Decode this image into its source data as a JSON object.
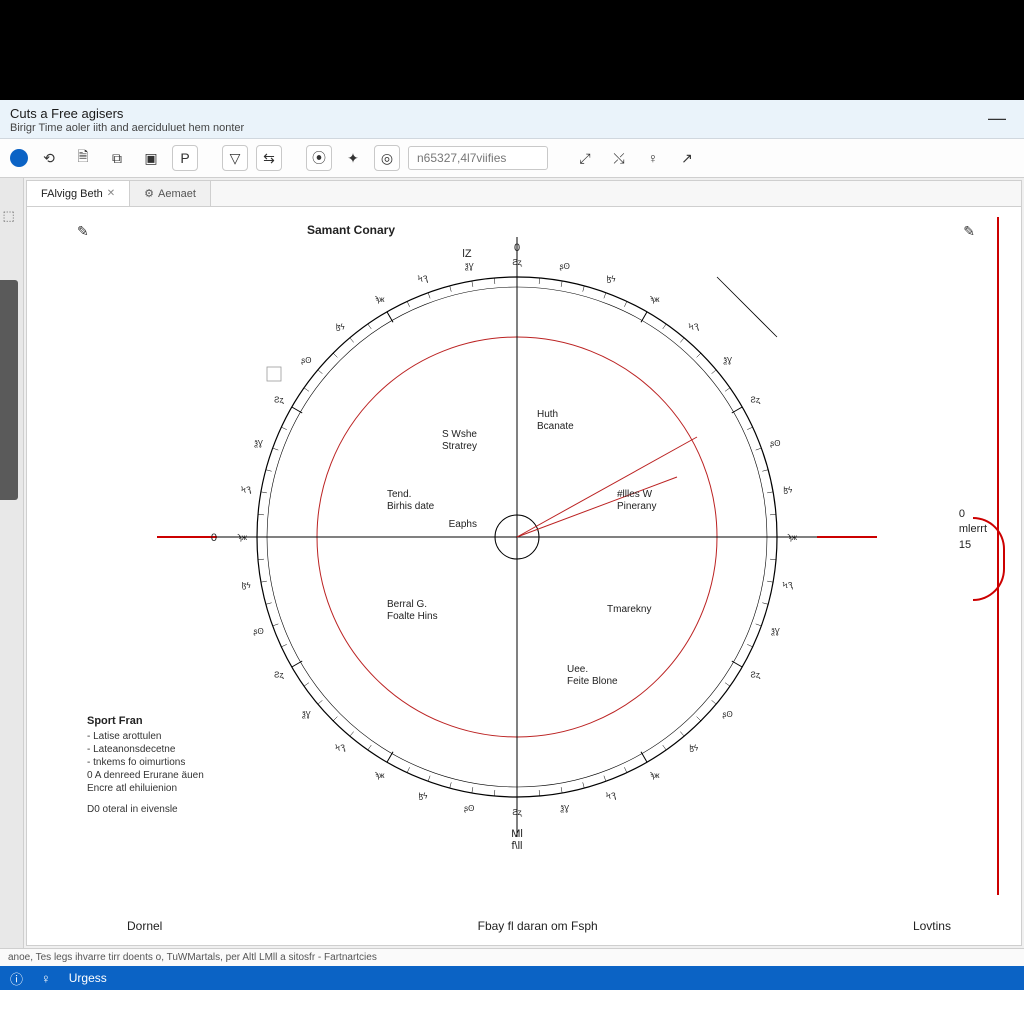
{
  "window": {
    "title": "Cuts a Free agisers",
    "subtitle": "Birigr Time aoler iith and aerciduluet hem nonter",
    "minimize": "—"
  },
  "toolbar": {
    "field_value": "n65327,4l7viifies"
  },
  "tabs": [
    {
      "label": "FAlvigg Beth",
      "closable": true
    },
    {
      "label": "Aemaet",
      "icon": "⚙"
    }
  ],
  "chart": {
    "title": "Samant Conary",
    "top_axis": "0",
    "top_axis_tick": "lZ",
    "left_mark": "0",
    "right": {
      "zero": "0",
      "label": "mlerrt",
      "val": "15"
    },
    "bottom_pair": {
      "a": "Ml",
      "b": "f\\ll"
    },
    "inner_labels": {
      "huth": "Huth",
      "bcanate": "Bcanate",
      "swhe": "S Wshe",
      "stratety": "Stratrey",
      "tend": "Tend.",
      "birhsdate": "Birhis date",
      "eaphs": "Eaphs",
      "altesw": "#llles W",
      "pinerany": "Pinerany",
      "berral": "Berral G.",
      "foalte": "Foalte Hins",
      "tmarekny": "Tmarekny",
      "uee": "Uee.",
      "feite": "Feite Blone"
    }
  },
  "legend": {
    "title": "Sport Fran",
    "items": [
      "- Latise arottulen",
      "- Lateanonsdecetne",
      "- tnkems fo oimurtions",
      "0 A denreed Erurane äuen",
      "  Encre atl ehiluienion"
    ],
    "note": "D0 oteral in eivensle"
  },
  "footer": {
    "left": "Dornel",
    "center": "Fbay fl daran om  Fsph",
    "right": "Lovtins"
  },
  "status": "anoe, Tes legs ihvarre tirr doents o, TuWMartals, per Altl LMll a sitosfr - Fartnartcies",
  "bottombar": {
    "label": "Urgess"
  },
  "chart_data": {
    "type": "polar",
    "title": "Samant Conary",
    "sectors": 12,
    "axis_top": 0,
    "right_marker": {
      "label": "mlerrt",
      "value": 15
    },
    "inner_annotations": [
      "Huth",
      "Bcanate",
      "S Wshe",
      "Stratrey",
      "Tend.",
      "Birhis date",
      "Eaphs",
      "#llles W",
      "Pinerany",
      "Berral G.",
      "Foalte Hins",
      "Tmarekny",
      "Uee.",
      "Feite Blone"
    ]
  }
}
